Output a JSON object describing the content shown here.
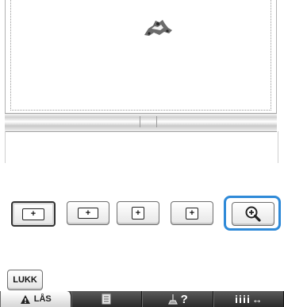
{
  "embroidery_frame": {
    "design_preview": "small embroidery design preview"
  },
  "size_buttons": [
    {
      "symbol": "+",
      "selected": true
    },
    {
      "symbol": "+",
      "selected": false
    },
    {
      "symbol": "+",
      "selected": false
    },
    {
      "symbol": "+",
      "selected": false
    }
  ],
  "zoom_button": {
    "icon": "magnifier-plus-icon"
  },
  "close_button": {
    "label": "LUKK"
  },
  "bottom_bar": {
    "lock_label": "LÅS",
    "list_icon": "list-icon",
    "help_icon": "sewing-help-icon",
    "help_symbol": "?",
    "thread_icon": "thread-bars-icon",
    "arrow_symbol": "↔"
  },
  "colors": {
    "highlight": "#2f8ad8",
    "warning": "#d9a400",
    "bar": "#3a3a3a"
  }
}
